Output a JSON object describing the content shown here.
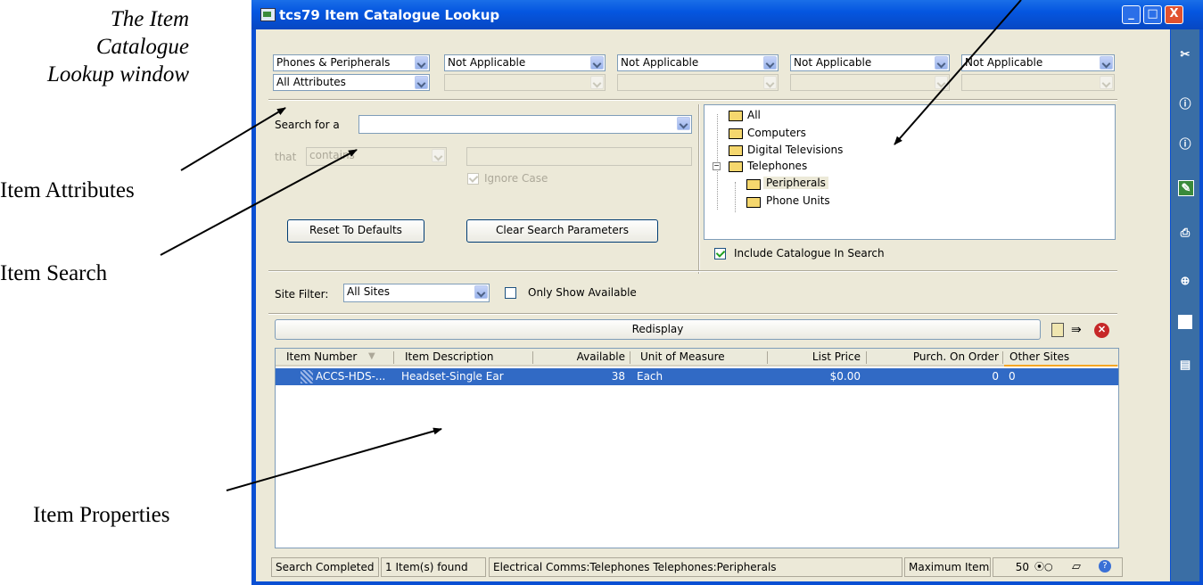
{
  "annotations": {
    "title_line1": "The Item",
    "title_line2": "Catalogue",
    "title_line3": "Lookup window",
    "item_attributes": "Item Attributes",
    "item_search": "Item Search",
    "item_properties": "Item Properties"
  },
  "window": {
    "title": "tcs79 Item Catalogue Lookup",
    "minimize_glyph": "_",
    "maximize_glyph": "□",
    "close_glyph": "X"
  },
  "attributes": {
    "combo1_value": "Phones & Peripherals",
    "combo1b_value": "All Attributes",
    "combo2_value": "Not Applicable",
    "combo3_value": "Not Applicable",
    "combo4_value": "Not Applicable",
    "combo5_value": "Not Applicable"
  },
  "search": {
    "search_for_label": "Search for a",
    "search_for_value": "",
    "that_label": "that",
    "that_value": "contains",
    "ignore_case_label": "Ignore Case",
    "reset_label": "Reset To Defaults",
    "clear_label": "Clear Search Parameters"
  },
  "catalogue": {
    "nodes": [
      "All",
      "Computers",
      "Digital Televisions",
      "Telephones",
      "Peripherals",
      "Phone Units"
    ],
    "include_label": "Include Catalogue In Search"
  },
  "site_filter": {
    "label": "Site Filter:",
    "value": "All Sites",
    "only_available_label": "Only Show Available"
  },
  "redisplay_label": "Redisplay",
  "grid": {
    "columns": [
      "Item Number",
      "Item Description",
      "Available",
      "Unit of Measure",
      "List Price",
      "Purch. On Order",
      "Other Sites"
    ],
    "rows": [
      [
        "ACCS-HDS-...",
        "Headset-Single Ear",
        "38",
        "Each",
        "$0.00",
        "0",
        "0"
      ]
    ]
  },
  "statusbar": {
    "status": "Search Completed",
    "count": "1 Item(s) found",
    "path": "Electrical Comms:Telephones  Telephones:Peripherals",
    "max_label": "Maximum Items",
    "max_value": "50"
  },
  "side_toolbar_icons": [
    "broom-icon",
    "info-icon",
    "info-icon-2",
    "edit-icon",
    "print-icon",
    "zoom-icon",
    "new-document-icon",
    "report-icon"
  ]
}
